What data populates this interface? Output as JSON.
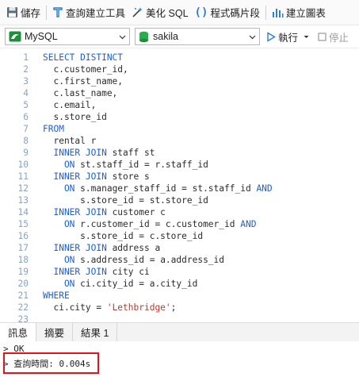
{
  "toolbar": {
    "save": "儲存",
    "query_builder": "查詢建立工具",
    "beautify_sql": "美化 SQL",
    "code_snippet": "程式碼片段",
    "create_chart": "建立圖表"
  },
  "connection": {
    "connection_name": "MySQL",
    "database": "sakila",
    "run_label": "執行",
    "stop_label": "停止"
  },
  "editor": {
    "lines": [
      [
        {
          "t": "kw",
          "v": "SELECT DISTINCT"
        }
      ],
      [
        {
          "t": "tx",
          "v": "  c.customer_id,"
        }
      ],
      [
        {
          "t": "tx",
          "v": "  c.first_name,"
        }
      ],
      [
        {
          "t": "tx",
          "v": "  c.last_name,"
        }
      ],
      [
        {
          "t": "tx",
          "v": "  c.email,"
        }
      ],
      [
        {
          "t": "tx",
          "v": "  s.store_id"
        }
      ],
      [
        {
          "t": "kw",
          "v": "FROM"
        }
      ],
      [
        {
          "t": "tx",
          "v": "  rental r"
        }
      ],
      [
        {
          "t": "kw",
          "v": "  INNER JOIN"
        },
        {
          "t": "tx",
          "v": " staff st"
        }
      ],
      [
        {
          "t": "kw",
          "v": "    ON"
        },
        {
          "t": "tx",
          "v": " st.staff_id = r.staff_id"
        }
      ],
      [
        {
          "t": "kw",
          "v": "  INNER JOIN"
        },
        {
          "t": "tx",
          "v": " store s"
        }
      ],
      [
        {
          "t": "kw",
          "v": "    ON"
        },
        {
          "t": "tx",
          "v": " s.manager_staff_id = st.staff_id "
        },
        {
          "t": "kw",
          "v": "AND"
        }
      ],
      [
        {
          "t": "tx",
          "v": "       s.store_id = st.store_id"
        }
      ],
      [
        {
          "t": "kw",
          "v": "  INNER JOIN"
        },
        {
          "t": "tx",
          "v": " customer c"
        }
      ],
      [
        {
          "t": "kw",
          "v": "    ON"
        },
        {
          "t": "tx",
          "v": " r.customer_id = c.customer_id "
        },
        {
          "t": "kw",
          "v": "AND"
        }
      ],
      [
        {
          "t": "tx",
          "v": "       s.store_id = c.store_id"
        }
      ],
      [
        {
          "t": "kw",
          "v": "  INNER JOIN"
        },
        {
          "t": "tx",
          "v": " address a"
        }
      ],
      [
        {
          "t": "kw",
          "v": "    ON"
        },
        {
          "t": "tx",
          "v": " s.address_id = a.address_id"
        }
      ],
      [
        {
          "t": "kw",
          "v": "  INNER JOIN"
        },
        {
          "t": "tx",
          "v": " city ci"
        }
      ],
      [
        {
          "t": "kw",
          "v": "    ON"
        },
        {
          "t": "tx",
          "v": " ci.city_id = a.city_id"
        }
      ],
      [
        {
          "t": "kw",
          "v": "WHERE"
        }
      ],
      [
        {
          "t": "tx",
          "v": "  ci.city = "
        },
        {
          "t": "str",
          "v": "'Lethbridge'"
        },
        {
          "t": "tx",
          "v": ";"
        }
      ],
      []
    ]
  },
  "tabs": [
    "訊息",
    "摘要",
    "結果 1"
  ],
  "output": {
    "status": "> OK",
    "query_time": "> 查詢時間: 0.004s"
  },
  "colors": {
    "keyword": "#1f5fd6",
    "string": "#c0392b",
    "highlight_box": "#e0151b",
    "line_numbers": "#8aa3bf"
  }
}
